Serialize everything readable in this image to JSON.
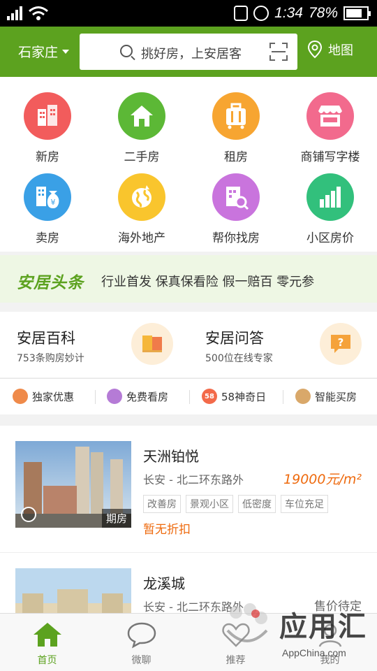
{
  "status_bar": {
    "time": "1:34",
    "battery": "78%",
    "battery_level": 0.78
  },
  "header": {
    "city": "石家庄",
    "search_placeholder": "挑好房，上安居客",
    "map_label": "地图"
  },
  "categories": [
    {
      "label": "新房",
      "icon": "building-icon",
      "color": "#f25c5c"
    },
    {
      "label": "二手房",
      "icon": "house-icon",
      "color": "#5cb836"
    },
    {
      "label": "租房",
      "icon": "suitcase-icon",
      "color": "#f7a531"
    },
    {
      "label": "商铺写字楼",
      "icon": "shop-icon",
      "color": "#f26a8d"
    },
    {
      "label": "卖房",
      "icon": "money-bag-icon",
      "color": "#3aa0e6"
    },
    {
      "label": "海外地产",
      "icon": "globe-icon",
      "color": "#f9c52d"
    },
    {
      "label": "帮你找房",
      "icon": "find-house-icon",
      "color": "#c974dd"
    },
    {
      "label": "小区房价",
      "icon": "bar-chart-icon",
      "color": "#32c07c"
    }
  ],
  "news": {
    "logo": "安居头条",
    "text": "行业首发 保真保看险 假一赔百 零元参"
  },
  "info": [
    {
      "title": "安居百科",
      "subtitle": "753条购房妙计",
      "icon": "book-icon"
    },
    {
      "title": "安居问答",
      "subtitle": "500位在线专家",
      "icon": "question-icon"
    }
  ],
  "quick": [
    {
      "label": "独家优惠",
      "icon": "tag-icon",
      "color": "#ef8a4a",
      "glyph": ""
    },
    {
      "label": "免费看房",
      "icon": "car-icon",
      "color": "#b57bd6",
      "glyph": ""
    },
    {
      "label": "58神奇日",
      "icon": "58-icon",
      "color": "#f36a4a",
      "glyph": "58"
    },
    {
      "label": "智能买房",
      "icon": "robot-icon",
      "color": "#d9a86a",
      "glyph": ""
    }
  ],
  "listings": [
    {
      "name": "天洲铂悦",
      "location": "长安 - 北二环东路外",
      "price": "19000元/m²",
      "tags": [
        "改善房",
        "景观小区",
        "低密度",
        "车位充足"
      ],
      "promo": "暂无折扣",
      "badge": "期房"
    },
    {
      "name": "龙溪城",
      "location": "长安 - 北二环东路外",
      "price": "售价待定",
      "tags": [],
      "promo": "",
      "badge": ""
    }
  ],
  "tabs": [
    {
      "label": "首页",
      "icon": "home-icon",
      "active": true
    },
    {
      "label": "微聊",
      "icon": "chat-icon",
      "active": false
    },
    {
      "label": "推荐",
      "icon": "heart-icon",
      "active": false
    },
    {
      "label": "我的",
      "icon": "profile-icon",
      "active": false
    }
  ],
  "watermark": {
    "text": "应用汇",
    "sub": "AppChina.com"
  }
}
